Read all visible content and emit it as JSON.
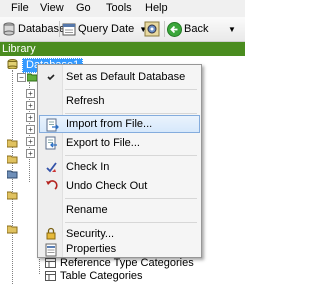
{
  "menubar": {
    "items": [
      "File",
      "View",
      "Go",
      "Tools",
      "Help"
    ]
  },
  "toolbar": {
    "database_label": "Database",
    "query_date_label": "Query Date",
    "back_label": "Back"
  },
  "panel": {
    "title": "Library"
  },
  "tree": {
    "selected_node": "Database1",
    "visible_items": [
      "Reference Type Categories",
      "Table Categories"
    ]
  },
  "context_menu": {
    "items": [
      {
        "label": "Set as Default Database",
        "icon": "check-mark-icon"
      },
      {
        "label": "Refresh",
        "icon": ""
      },
      {
        "label": "Import from File...",
        "icon": "import-icon"
      },
      {
        "label": "Export to File...",
        "icon": "export-icon"
      },
      {
        "label": "Check In",
        "icon": "check-in-icon"
      },
      {
        "label": "Undo Check Out",
        "icon": "undo-check-out-icon"
      },
      {
        "label": "Rename",
        "icon": ""
      },
      {
        "label": "Security...",
        "icon": "lock-icon"
      },
      {
        "label": "Properties",
        "icon": "properties-icon"
      }
    ],
    "highlighted": "Import from File..."
  },
  "colors": {
    "library_header": "#4a8c1f",
    "selection": "#3399ff",
    "menu_highlight": "#d6e8fb"
  }
}
